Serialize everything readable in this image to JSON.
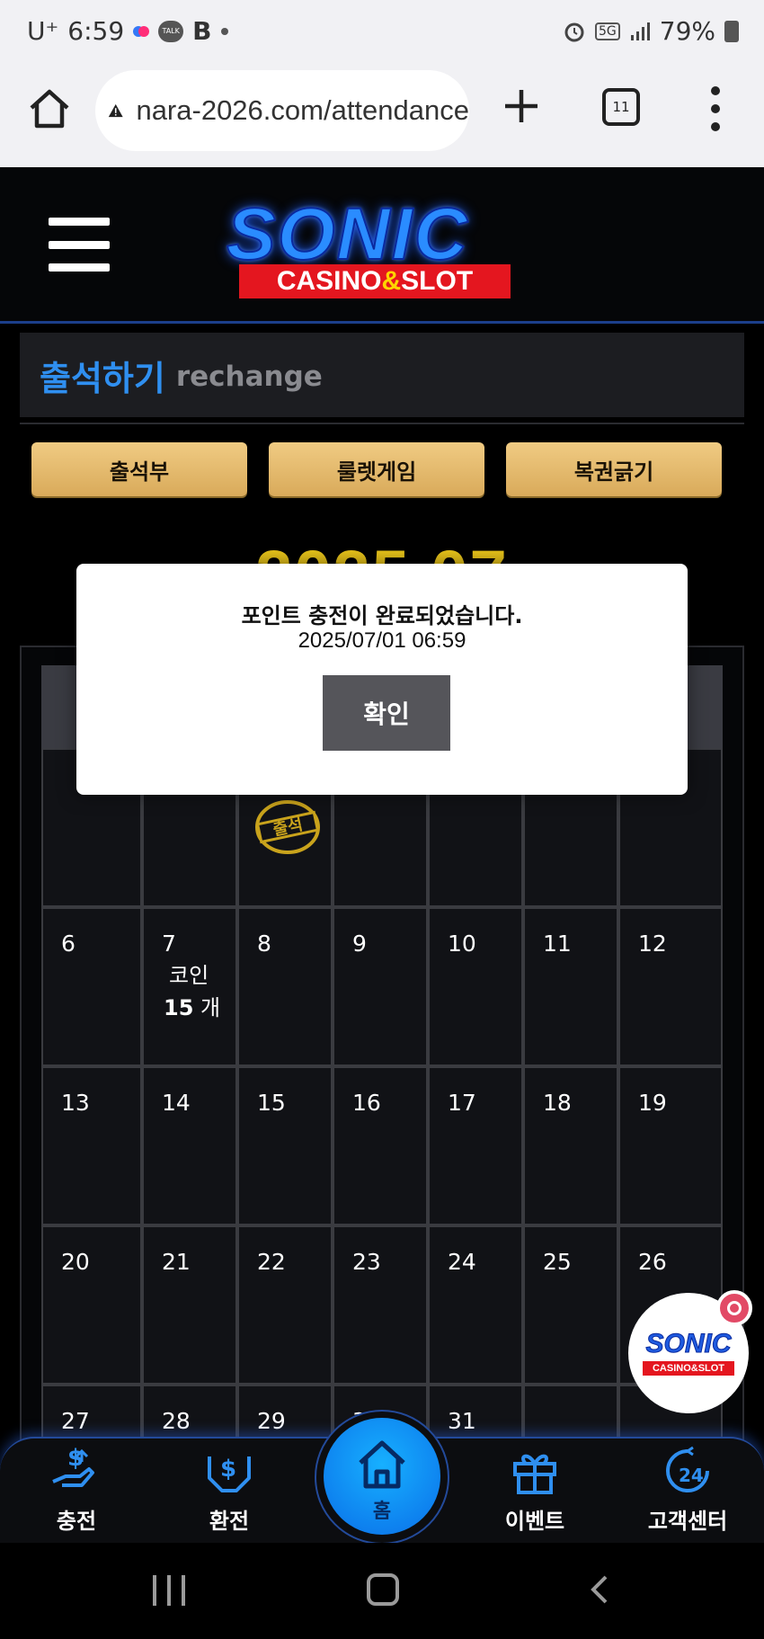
{
  "status_bar": {
    "carrier": "U⁺",
    "time": "6:59",
    "talk_label": "TALK",
    "b_label": "B",
    "network": "5G",
    "battery": "79%"
  },
  "browser": {
    "url": "nara-2026.com/attendance",
    "tab_count": "11"
  },
  "header": {
    "logo_main": "SONIC",
    "logo_sub_left": "CASINO",
    "logo_sub_amp": "&",
    "logo_sub_right": "SLOT"
  },
  "page": {
    "title": "출석하기",
    "subtitle": "rechange",
    "tabs": [
      "출석부",
      "룰렛게임",
      "복권긁기"
    ],
    "month_title": "2025.07"
  },
  "calendar": {
    "stamp_label": "출석",
    "coin_label": "코인",
    "coin_amount": "15",
    "coin_unit": "개",
    "days": [
      "6",
      "7",
      "8",
      "9",
      "10",
      "11",
      "12",
      "13",
      "14",
      "15",
      "16",
      "17",
      "18",
      "19",
      "20",
      "21",
      "22",
      "23",
      "24",
      "25",
      "26",
      "27",
      "28",
      "29",
      "30",
      "31"
    ]
  },
  "modal": {
    "message": "포인트 충전이 완료되었습니다.",
    "datetime": "2025/07/01 06:59",
    "confirm_label": "확인"
  },
  "floating_badge": {
    "main": "SONIC",
    "sub": "CASINO&SLOT"
  },
  "bottom_nav": {
    "items": [
      "충전",
      "환전",
      "홈",
      "이벤트",
      "고객센터"
    ]
  },
  "colors": {
    "accent_blue": "#2f8ff0",
    "gold_button": "#e6bb6c",
    "month_gold": "#e6c21a",
    "home_blue": "#0a8cff"
  }
}
